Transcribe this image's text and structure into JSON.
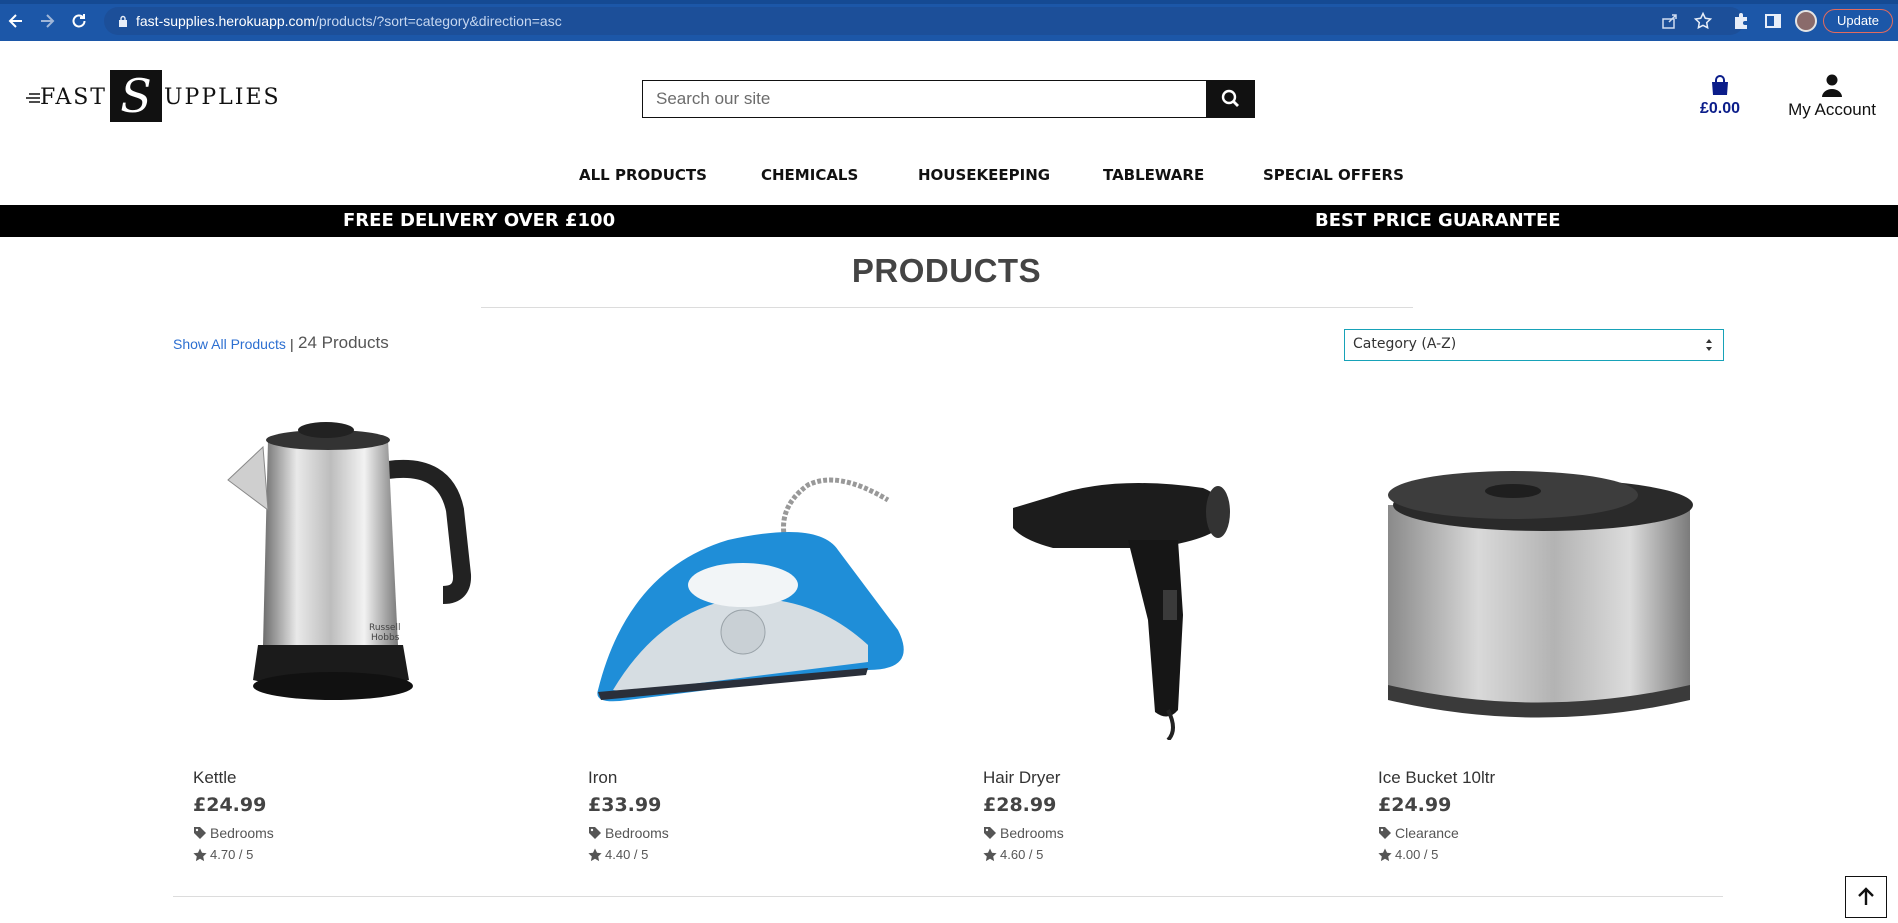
{
  "browser": {
    "url_host": "fast-supplies.herokuapp.com",
    "url_path": "/products/?sort=category&direction=asc",
    "update_label": "Update",
    "icons": [
      "back-icon",
      "forward-icon",
      "reload-icon",
      "lock-icon",
      "share-icon",
      "star-icon",
      "extensions-icon",
      "sidepanel-icon"
    ]
  },
  "header": {
    "logo": {
      "left": "FAST",
      "mark": "S",
      "right": "UPPLIES"
    },
    "search_placeholder": "Search our site",
    "cart_total": "£0.00",
    "account_label": "My Account"
  },
  "nav": {
    "items": [
      "ALL PRODUCTS",
      "CHEMICALS",
      "HOUSEKEEPING",
      "TABLEWARE",
      "SPECIAL OFFERS"
    ]
  },
  "banner": {
    "left": "FREE DELIVERY OVER £100",
    "right": "BEST PRICE GUARANTEE"
  },
  "page": {
    "title": "PRODUCTS",
    "show_all": "Show All Products",
    "separator": "|",
    "count": "24 Products",
    "sort_value": "Category (A-Z)"
  },
  "products": [
    {
      "name": "Kettle",
      "price": "£24.99",
      "category": "Bedrooms",
      "rating": "4.70 / 5"
    },
    {
      "name": "Iron",
      "price": "£33.99",
      "category": "Bedrooms",
      "rating": "4.40 / 5"
    },
    {
      "name": "Hair Dryer",
      "price": "£28.99",
      "category": "Bedrooms",
      "rating": "4.60 / 5"
    },
    {
      "name": "Ice Bucket 10ltr",
      "price": "£24.99",
      "category": "Clearance",
      "rating": "4.00 / 5"
    }
  ],
  "colors": {
    "browser_bar": "#1c57a8",
    "link": "#2c6fd1",
    "cart_total": "#0b1d8a",
    "banner": "#000000",
    "sort_border": "#17a2b8"
  }
}
